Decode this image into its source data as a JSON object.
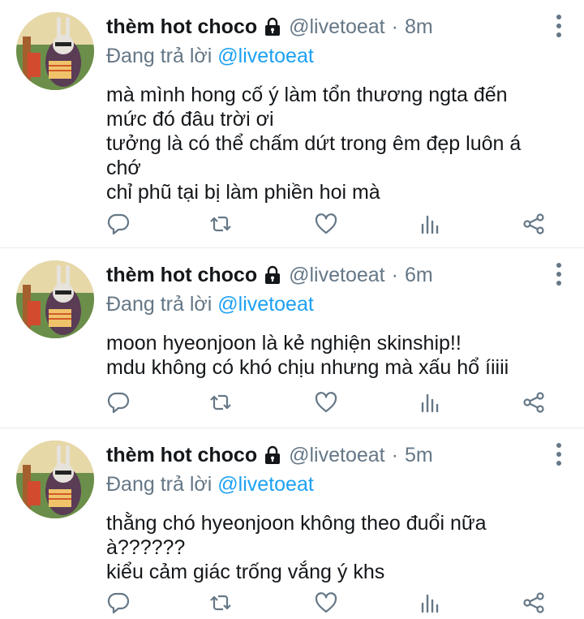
{
  "colors": {
    "name": "#14171a",
    "meta": "#657786",
    "mention": "#1da1f2",
    "divider": "#e6ecf0"
  },
  "icons": [
    "more-vertical-icon",
    "reply-icon",
    "retweet-icon",
    "like-icon",
    "stats-icon",
    "share-icon",
    "lock-icon"
  ],
  "tweets": [
    {
      "author": "thèm hot choco",
      "handle": "@livetoeat",
      "time": "8m",
      "replying_prefix": "Đang trả lời",
      "replying_to": "@livetoeat",
      "lines": [
        "mà mình hong cố ý làm tổn thương ngta đến",
        "mức đó đâu trời ơi",
        "tưởng là có thể chấm dứt trong êm đẹp luôn á",
        "chớ",
        "chỉ phũ tại bị làm phiền hoi mà"
      ]
    },
    {
      "author": "thèm hot choco",
      "handle": "@livetoeat",
      "time": "6m",
      "replying_prefix": "Đang trả lời",
      "replying_to": "@livetoeat",
      "lines": [
        "moon hyeonjoon là kẻ nghiện skinship!!",
        "mdu không có khó chịu nhưng mà xấu hổ íiiii"
      ]
    },
    {
      "author": "thèm hot choco",
      "handle": "@livetoeat",
      "time": "5m",
      "replying_prefix": "Đang trả lời",
      "replying_to": "@livetoeat",
      "lines": [
        "thằng chó hyeonjoon không theo đuổi nữa",
        "à??????",
        "kiểu cảm giác trống vắng ý khs"
      ]
    }
  ]
}
